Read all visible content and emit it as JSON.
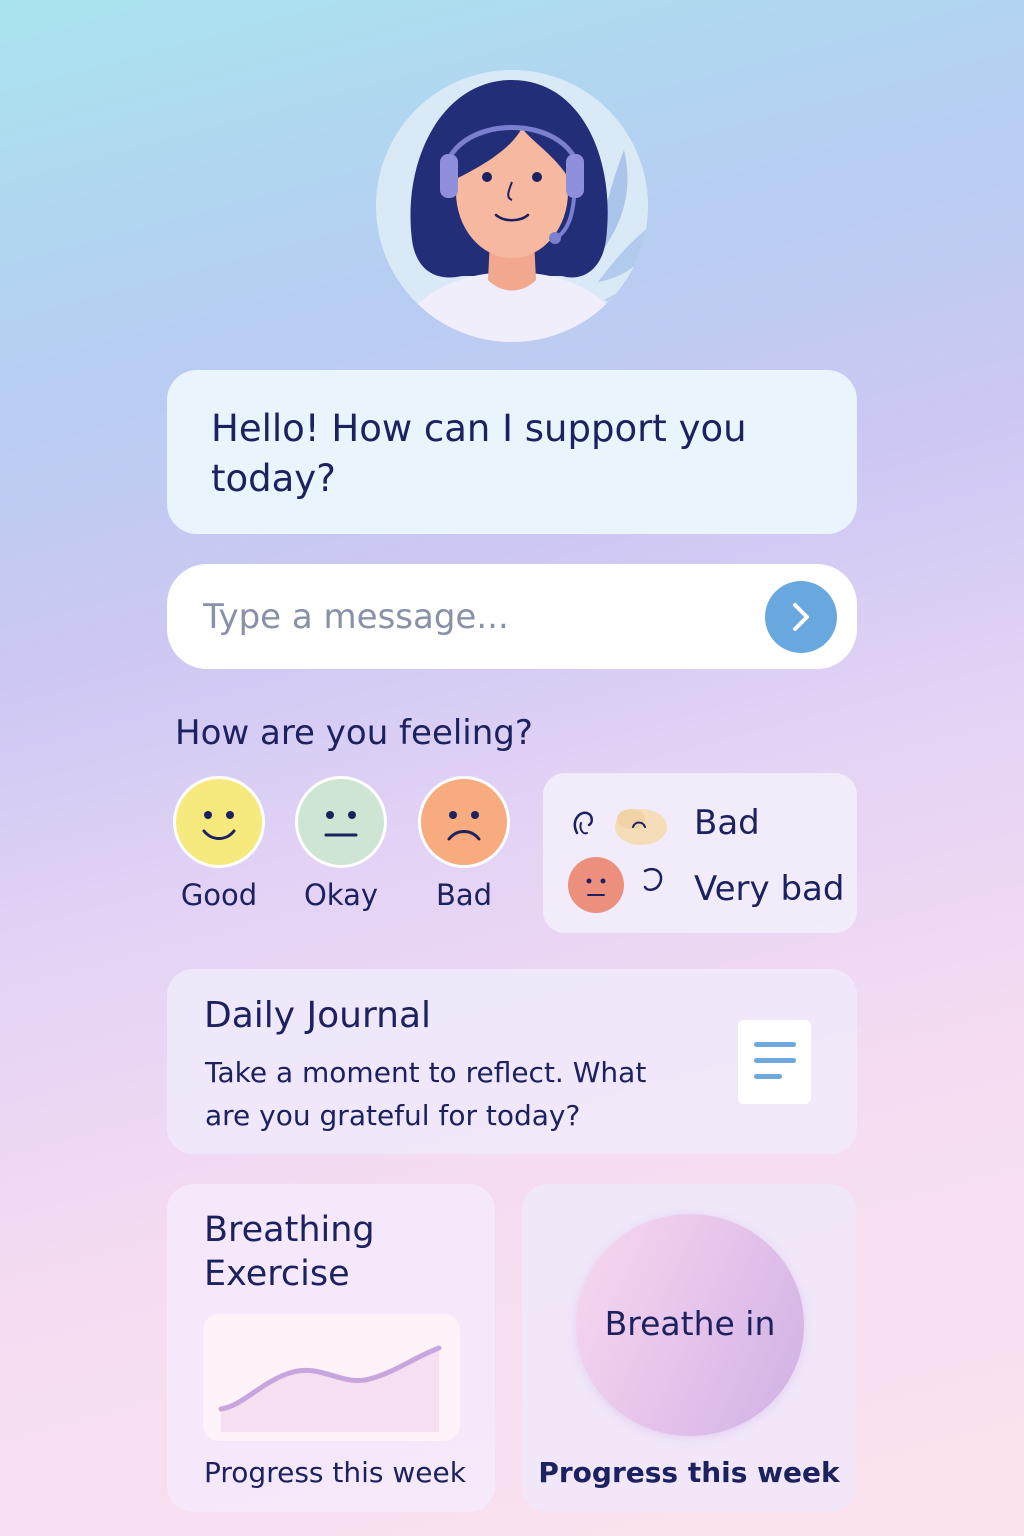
{
  "chat": {
    "greeting": "Hello! How can I support you today?",
    "input_placeholder": "Type a message..."
  },
  "mood": {
    "title": "How are you feeling?",
    "options": [
      {
        "label": "Good",
        "color": "#f6ea7f"
      },
      {
        "label": "Okay",
        "color": "#cfe5d4"
      },
      {
        "label": "Bad",
        "color": "#f8ab7e"
      }
    ],
    "extra_options": [
      {
        "label": "Bad"
      },
      {
        "label": "Very bad",
        "color": "#ec8f7d"
      }
    ]
  },
  "journal": {
    "title": "Daily Journal",
    "prompt": "Take a moment to reflect. What are you grateful for today?"
  },
  "breathing": {
    "title": "Breathing Exercise",
    "progress_label": "Progress this week"
  },
  "breathe": {
    "instruction": "Breathe in",
    "progress_label": "Progress this week"
  },
  "colors": {
    "accent": "#69a8de",
    "text": "#1c2160"
  }
}
